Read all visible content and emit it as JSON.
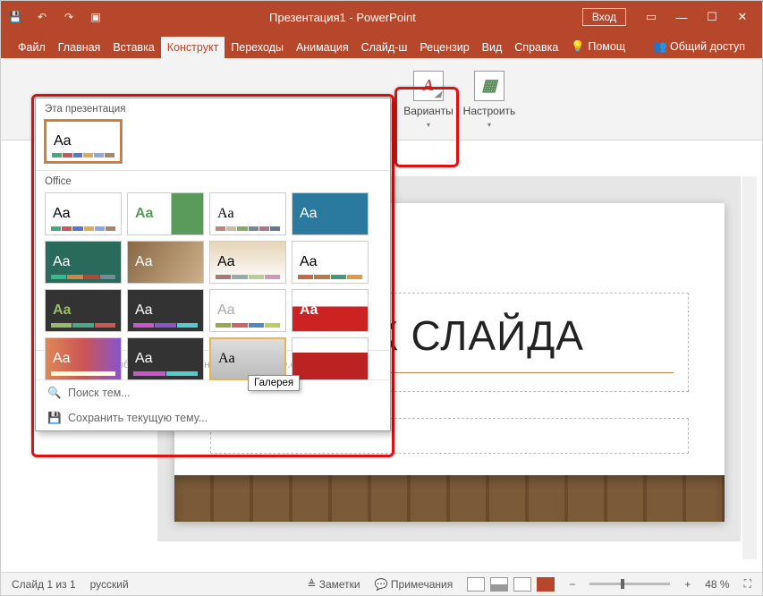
{
  "title": "Презентация1 - PowerPoint",
  "signin": "Вход",
  "tabs": [
    "Файл",
    "Главная",
    "Вставка",
    "Конструкт",
    "Переходы",
    "Анимация",
    "Слайд-ш",
    "Рецензир",
    "Вид",
    "Справка"
  ],
  "active_tab_index": 3,
  "tell_me": {
    "placeholder": "Помощ"
  },
  "share": "Общий доступ",
  "ribbon": {
    "variants": "Варианты",
    "configure": "Настроить"
  },
  "themes_panel": {
    "section1": "Эта презентация",
    "section2": "Office",
    "tooltip": "Галерея",
    "disabled": "Разрешить обновление контента с сайта Office.com...",
    "search": "Поиск тем...",
    "save": "Сохранить текущую тему..."
  },
  "slide": {
    "title_visible": "ВОК СЛАЙДА"
  },
  "status": {
    "slide": "Слайд 1 из 1",
    "lang": "русский",
    "notes": "Заметки",
    "comments": "Примечания",
    "zoom": "48 %"
  }
}
